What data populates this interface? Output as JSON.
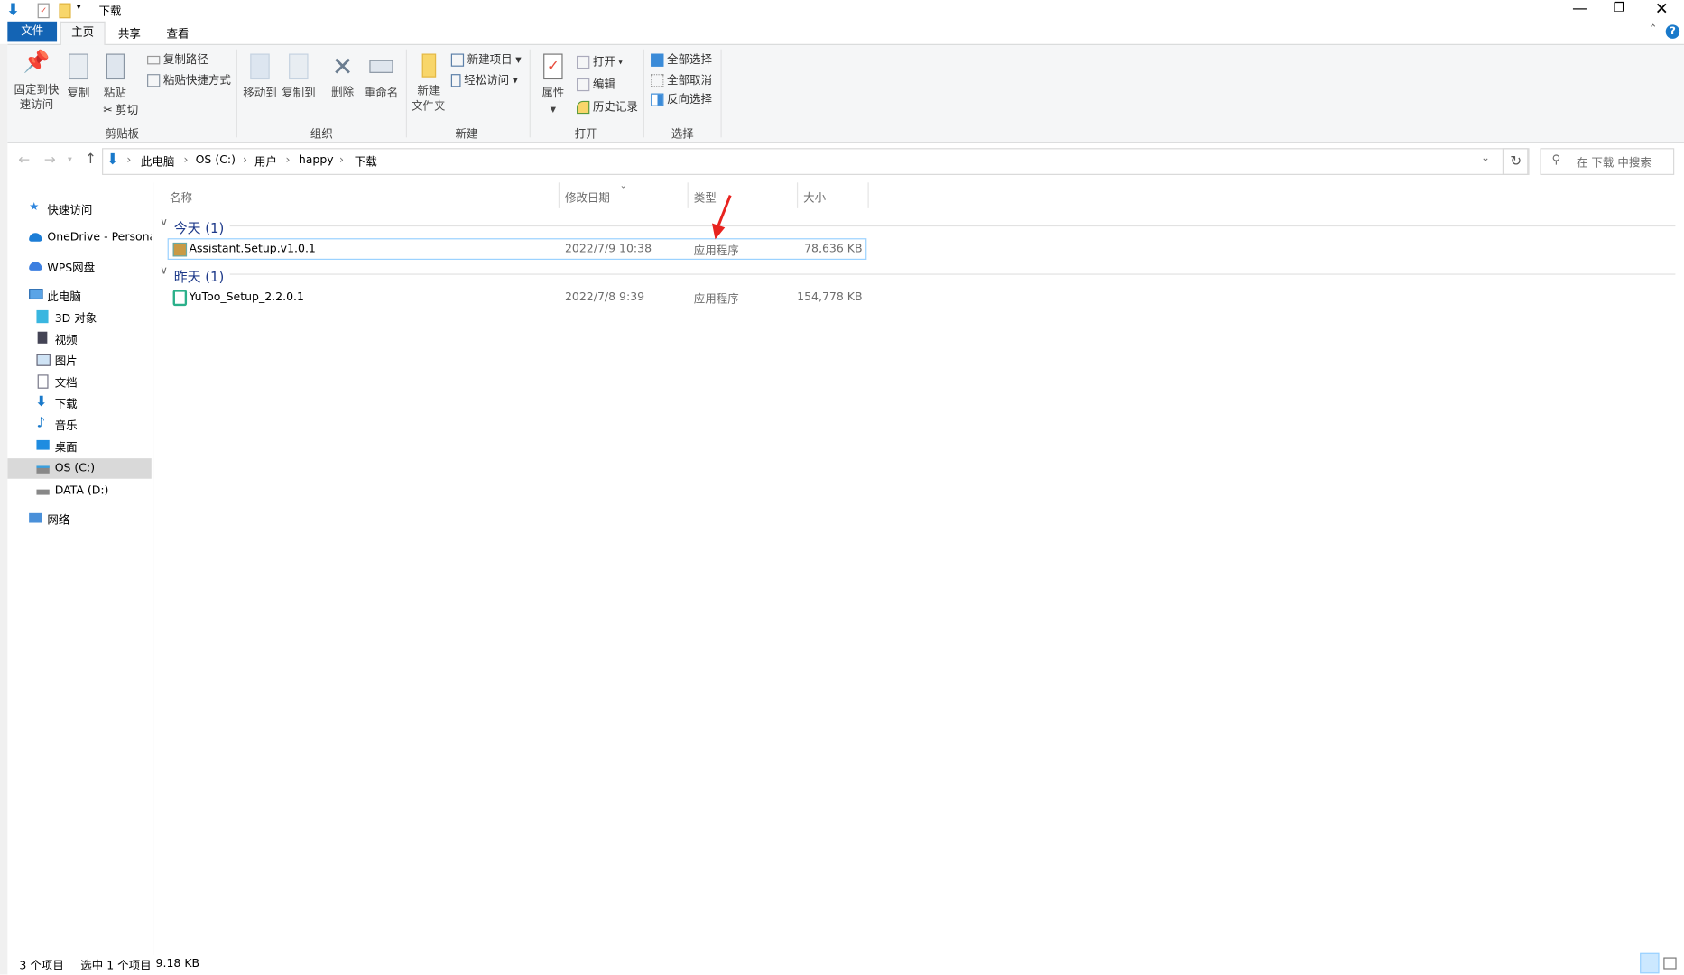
{
  "window": {
    "title": "下载"
  },
  "tabs": [
    {
      "label": "文件"
    },
    {
      "label": "主页"
    },
    {
      "label": "共享"
    },
    {
      "label": "查看"
    }
  ],
  "ribbon": {
    "clipboard": {
      "label": "剪贴板",
      "pin": "固定到快\n速访问",
      "pin1": "固定到快",
      "pin2": "速访问",
      "copy": "复制",
      "paste": "粘贴",
      "copy_path": "复制路径",
      "paste_shortcut": "粘贴快捷方式",
      "cut": "剪切"
    },
    "organize": {
      "label": "组织",
      "move_to": "移动到",
      "copy_to": "复制到",
      "delete": "删除",
      "rename": "重命名"
    },
    "new": {
      "label": "新建",
      "new_folder1": "新建",
      "new_folder2": "文件夹",
      "new_item": "新建项目",
      "easy_access": "轻松访问"
    },
    "open": {
      "label": "打开",
      "properties": "属性",
      "open": "打开",
      "edit": "编辑",
      "history": "历史记录"
    },
    "select": {
      "label": "选择",
      "select_all": "全部选择",
      "select_none": "全部取消",
      "invert": "反向选择"
    }
  },
  "address": {
    "crumbs": [
      "此电脑",
      "OS (C:)",
      "用户",
      "happy",
      "下载"
    ],
    "search_placeholder": "在 下载 中搜索"
  },
  "nav": {
    "items": [
      "快速访问",
      "OneDrive - Persona",
      "WPS网盘",
      "此电脑",
      "3D 对象",
      "视频",
      "图片",
      "文档",
      "下载",
      "音乐",
      "桌面",
      "OS (C:)",
      "DATA (D:)",
      "网络"
    ]
  },
  "columns": {
    "name": "名称",
    "modified": "修改日期",
    "type": "类型",
    "size": "大小"
  },
  "groups": [
    {
      "label": "今天 (1)",
      "files": [
        {
          "name": "Assistant.Setup.v1.0.1",
          "modified": "2022/7/9 10:38",
          "type": "应用程序",
          "size": "78,636 KB"
        }
      ]
    },
    {
      "label": "昨天 (1)",
      "files": [
        {
          "name": "YuToo_Setup_2.2.0.1",
          "modified": "2022/7/8 9:39",
          "type": "应用程序",
          "size": "154,778 KB"
        }
      ]
    }
  ],
  "status": {
    "count": "3 个项目",
    "selected": "选中 1 个项目",
    "size": "9.18 KB"
  },
  "colors": {
    "accent": "#1979ca",
    "file_tab": "#1464b4",
    "group_text": "#1e3a8a",
    "selection_border": "#99d1ff",
    "annotation": "#e8231f"
  }
}
